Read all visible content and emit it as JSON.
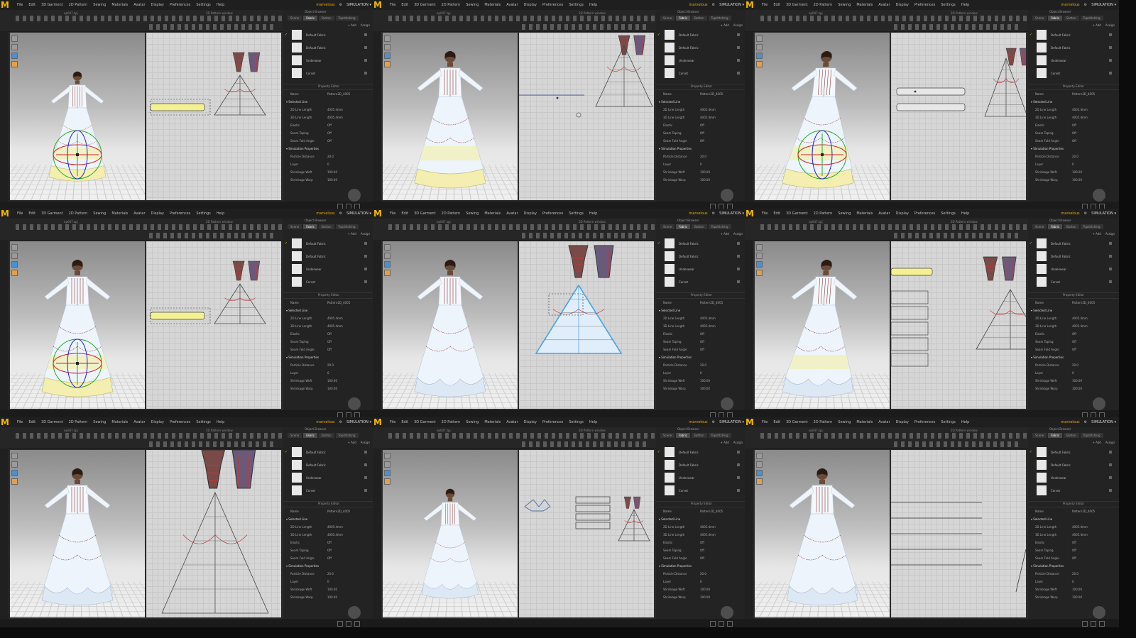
{
  "app": {
    "logo_letter": "M",
    "accent_color": "#f2b600",
    "menu": [
      "File",
      "Edit",
      "3D Garment",
      "2D Pattern",
      "Sewing",
      "Materials",
      "Avatar",
      "Display",
      "Preferences",
      "Settings",
      "Help"
    ],
    "mode_label": "SIMULATION",
    "user_label": "marvelous",
    "file_title": "ep047.zpj",
    "pattern_window_title": "2D Pattern window"
  },
  "object_browser": {
    "title": "Object Browser",
    "tabs": [
      "Scene",
      "Fabric",
      "Button",
      "Topstitching"
    ],
    "active_tab": "Fabric",
    "add_label": "+ Add",
    "assign_label": "Assign",
    "fabrics": [
      "Default Fabric",
      "Default Fabric",
      "Underwear",
      "Corset"
    ]
  },
  "property_editor": {
    "title": "Property Editor",
    "name_label": "Name",
    "name_value": "Pattern2D_4005",
    "sections": [
      {
        "title": "Selected Line",
        "rows": [
          [
            "2D Line Length",
            "4005.4mm"
          ],
          [
            "3D Line Length",
            "4005.4mm"
          ],
          [
            "Elastic",
            "Off"
          ],
          [
            "Seam Taping",
            "Off"
          ],
          [
            "Seam Fold Angle",
            "Off"
          ]
        ]
      },
      {
        "title": "Simulation Properties",
        "rows": [
          [
            "Particle Distance",
            "20.0"
          ],
          [
            "Layer",
            "0"
          ],
          [
            "Shrinkage Weft",
            "100.00"
          ],
          [
            "Shrinkage Warp",
            "100.00"
          ]
        ]
      }
    ]
  },
  "tiles": [
    {
      "pose": "small",
      "pattern": "belt-and-skirt",
      "highlight": true,
      "gizmo": true,
      "ruffle": true
    },
    {
      "pose": "front",
      "pattern": "line-and-skirt",
      "highlight": true,
      "gizmo": false,
      "ruffle": true
    },
    {
      "pose": "side",
      "pattern": "belts",
      "highlight": true,
      "gizmo": true,
      "ruffle": true
    },
    {
      "pose": "front",
      "pattern": "belt-and-skirt",
      "highlight": true,
      "gizmo": true,
      "ruffle": true
    },
    {
      "pose": "front",
      "pattern": "skirt-selected",
      "highlight": false,
      "gizmo": false,
      "ruffle": false
    },
    {
      "pose": "side",
      "pattern": "belts-stack",
      "highlight": true,
      "gizmo": false,
      "ruffle": false
    },
    {
      "pose": "front",
      "pattern": "skirt-large",
      "highlight": false,
      "gizmo": false,
      "ruffle": false
    },
    {
      "pose": "small",
      "pattern": "strips",
      "highlight": false,
      "gizmo": false,
      "ruffle": false
    },
    {
      "pose": "front",
      "pattern": "lines",
      "highlight": false,
      "gizmo": false,
      "ruffle": false
    }
  ]
}
